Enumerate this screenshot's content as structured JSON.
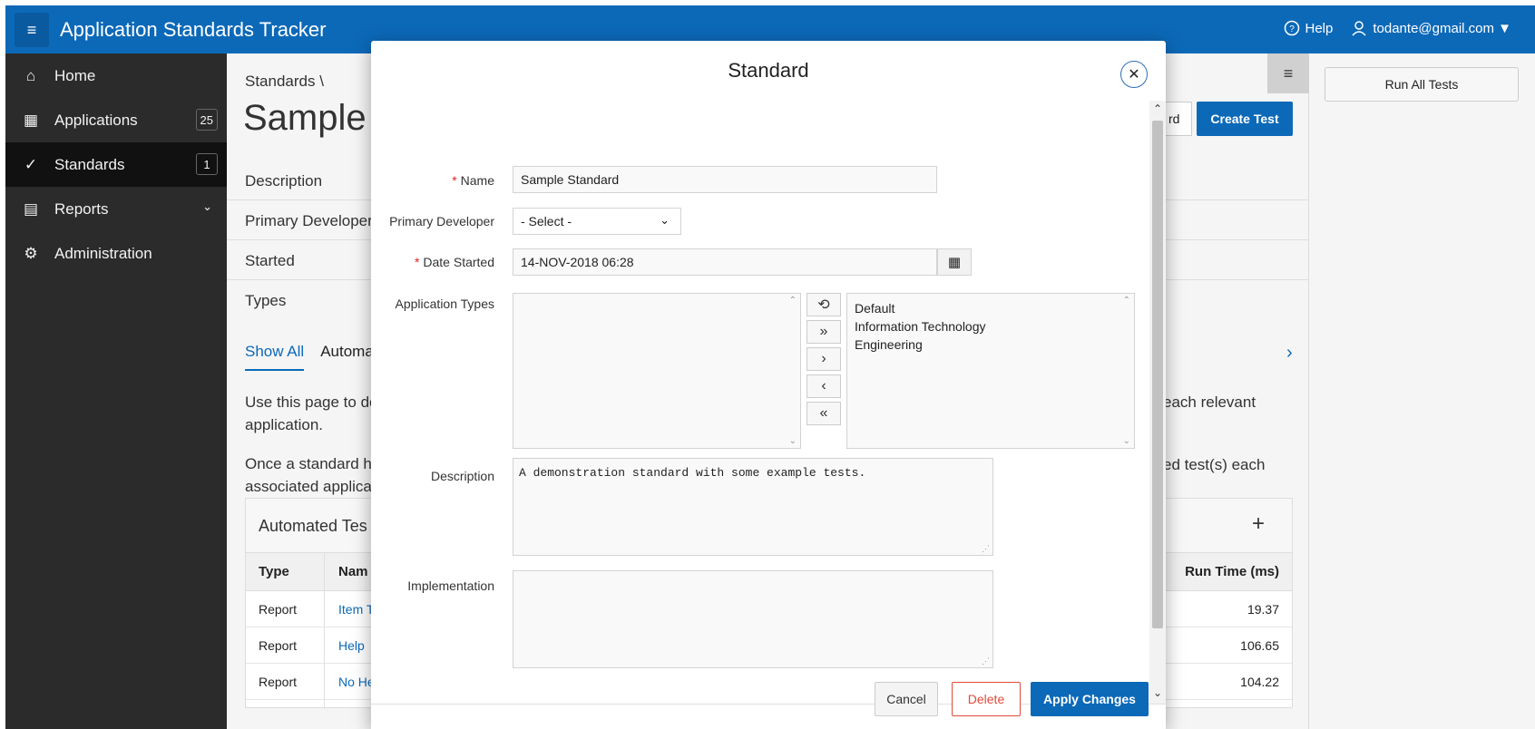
{
  "header": {
    "app_title": "Application Standards Tracker",
    "help_label": "Help",
    "user_label": "todante@gmail.com ▼"
  },
  "sidebar": {
    "items": [
      {
        "label": "Home",
        "icon": "home-icon"
      },
      {
        "label": "Applications",
        "icon": "grid-icon",
        "badge": "25"
      },
      {
        "label": "Standards",
        "icon": "check-icon",
        "badge": "1"
      },
      {
        "label": "Reports",
        "icon": "table-icon"
      },
      {
        "label": "Administration",
        "icon": "gear-icon"
      }
    ]
  },
  "background": {
    "breadcrumb": "Standards \\",
    "title": "Sample",
    "partial_button": "rd",
    "create_test": "Create Test",
    "run_all_tests": "Run All Tests",
    "rows": [
      "Description",
      "Primary Developer",
      "Started",
      "Types"
    ],
    "tabs": [
      "Show All",
      "Automa"
    ],
    "para1_line1": "Use this page to de",
    "para1_line2": "application.",
    "para1_right": "each relevant",
    "para2_line1": "Once a standard ha",
    "para2_line2": "associated applica",
    "para2_right": "ed test(s) each",
    "region_title": "Automated Tes",
    "region_add": "+",
    "col_type": "Type",
    "col_name": "Nam",
    "col_runtime": "Run Time (ms)",
    "table_rows": [
      {
        "type": "Report",
        "name": "Item T",
        "runtime": "19.37"
      },
      {
        "type": "Report",
        "name": "Help",
        "runtime": "106.65"
      },
      {
        "type": "Report",
        "name": "No He",
        "runtime": "104.22"
      }
    ]
  },
  "dialog": {
    "title": "Standard",
    "name_label": "Name",
    "name_value": "Sample Standard",
    "primary_dev_label": "Primary Developer",
    "primary_dev_value": "- Select -",
    "date_label": "Date Started",
    "date_value": "14-NOV-2018 06:28",
    "app_types_label": "Application Types",
    "app_types_selected": [
      "Default",
      "Information Technology",
      "Engineering"
    ],
    "description_label": "Description",
    "description_value": "A demonstration standard with some example tests.",
    "implementation_label": "Implementation",
    "implementation_value": "",
    "cancel_label": "Cancel",
    "delete_label": "Delete",
    "apply_label": "Apply Changes"
  },
  "colors": {
    "brand": "#0c69b8",
    "danger": "#e04a3a",
    "sidebar": "#2b2b2b"
  }
}
